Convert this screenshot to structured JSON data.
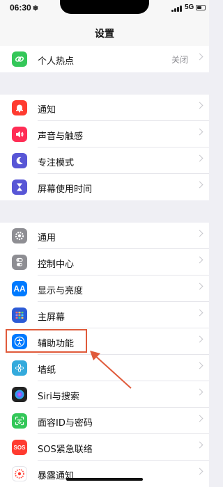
{
  "status": {
    "time": "06:30",
    "snow": "❄",
    "network": "5G"
  },
  "nav": {
    "title": "设置"
  },
  "groups": [
    {
      "items": [
        {
          "label": "个人热点",
          "value": "关闭",
          "color": "#34c759",
          "icon": "link-icon"
        }
      ]
    },
    {
      "items": [
        {
          "label": "通知",
          "color": "#ff3b30",
          "icon": "bell-icon"
        },
        {
          "label": "声音与触感",
          "color": "#ff2d55",
          "icon": "speaker-icon"
        },
        {
          "label": "专注模式",
          "color": "#5856d6",
          "icon": "moon-icon"
        },
        {
          "label": "屏幕使用时间",
          "color": "#5856d6",
          "icon": "hourglass-icon"
        }
      ]
    },
    {
      "items": [
        {
          "label": "通用",
          "color": "#8e8e93",
          "icon": "gear-icon"
        },
        {
          "label": "控制中心",
          "color": "#8e8e93",
          "icon": "toggles-icon"
        },
        {
          "label": "显示与亮度",
          "color": "#007aff",
          "icon": "text-size-icon",
          "glyph": "AA"
        },
        {
          "label": "主屏幕",
          "color": "#2c5bd6",
          "icon": "grid-icon"
        },
        {
          "label": "辅助功能",
          "color": "#007aff",
          "icon": "accessibility-icon"
        },
        {
          "label": "墙纸",
          "color": "#34aadc",
          "icon": "flower-icon"
        },
        {
          "label": "Siri与搜索",
          "color": "#222222",
          "icon": "siri-icon"
        },
        {
          "label": "面容ID与密码",
          "color": "#34c759",
          "icon": "face-id-icon"
        },
        {
          "label": "SOS紧急联络",
          "color": "#ff3b30",
          "icon": "sos-icon",
          "glyph": "SOS"
        },
        {
          "label": "暴露通知",
          "color": "#ffffff",
          "icon": "exposure-icon"
        }
      ]
    }
  ],
  "annotation": {
    "highlight_color": "#e05a3a"
  }
}
